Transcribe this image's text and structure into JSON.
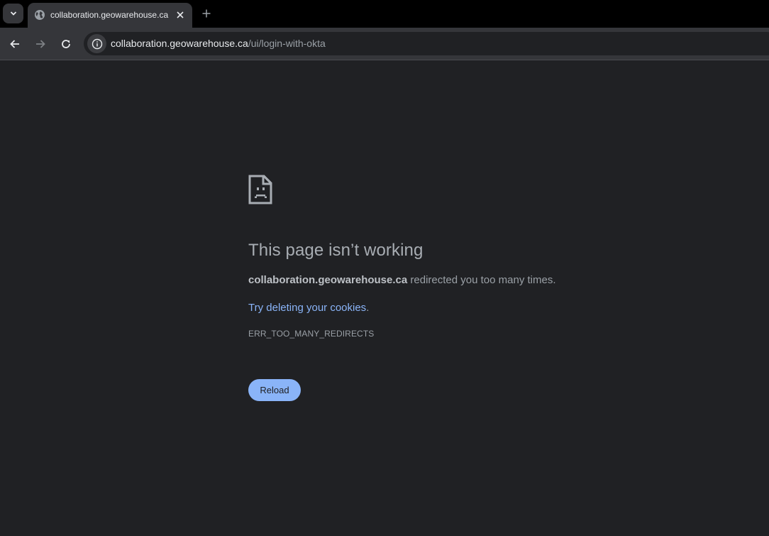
{
  "browser": {
    "tab": {
      "title": "collaboration.geowarehouse.ca",
      "favicon": "globe-icon"
    },
    "address_bar": {
      "host": "collaboration.geowarehouse.ca",
      "path": "/ui/login-with-okta"
    },
    "icons": {
      "tab_search": "chevron-down-icon",
      "close_tab": "close-icon",
      "new_tab": "plus-icon",
      "back": "arrow-left-icon",
      "forward": "arrow-right-icon",
      "reload": "reload-icon",
      "site_info": "info-icon"
    }
  },
  "error_page": {
    "icon": "sad-document-icon",
    "heading": "This page isn’t working",
    "host": "collaboration.geowarehouse.ca",
    "summary_tail": " redirected you too many times.",
    "suggestion_link": "Try deleting your cookies",
    "suggestion_end": ".",
    "error_code": "ERR_TOO_MANY_REDIRECTS",
    "reload_label": "Reload"
  },
  "colors": {
    "background": "#202124",
    "toolbar": "#35363a",
    "tabstrip": "#000000",
    "link": "#8ab4f8",
    "button": "#8ab4f8"
  }
}
